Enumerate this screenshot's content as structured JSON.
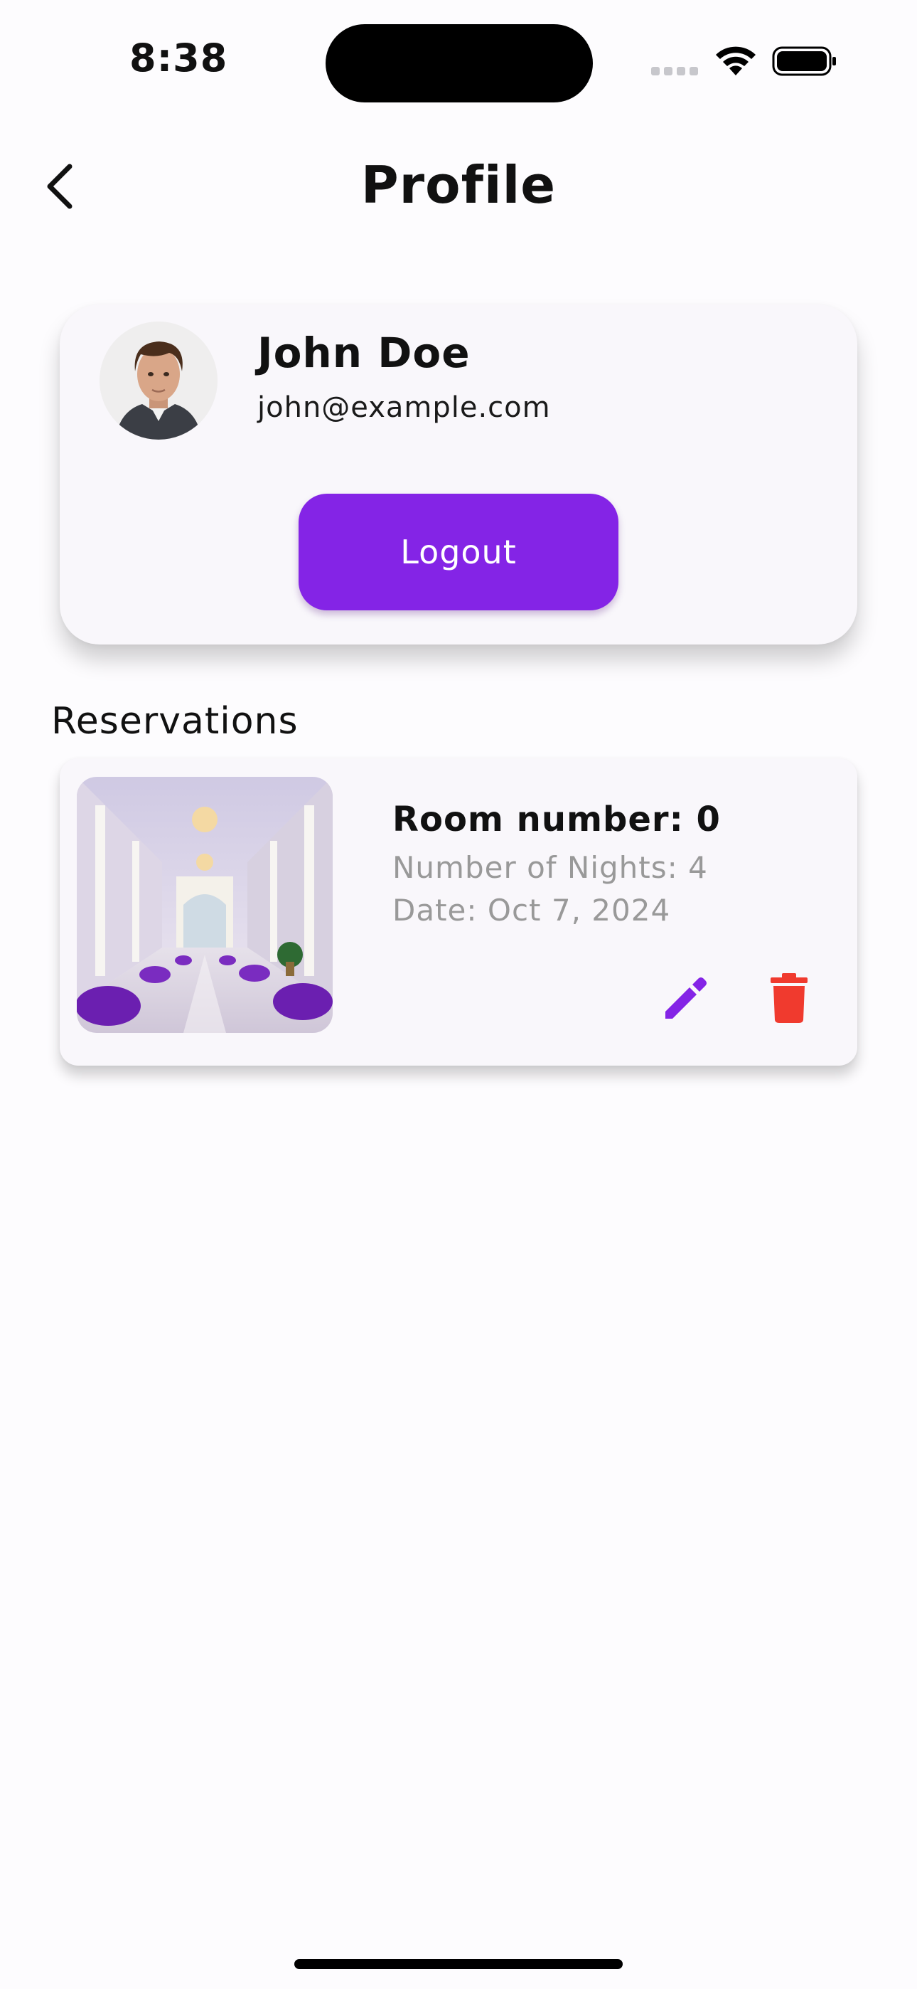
{
  "status_bar": {
    "time": "8:38"
  },
  "header": {
    "title": "Profile",
    "back_icon": "chevron-left-icon"
  },
  "profile": {
    "name": "John Doe",
    "email": "john@example.com",
    "logout_label": "Logout"
  },
  "reservations": {
    "title": "Reservations",
    "items": [
      {
        "room": "Room number: 0",
        "nights": "Number of Nights: 4",
        "date": "Date: Oct 7, 2024",
        "edit_icon": "pencil-icon",
        "delete_icon": "trash-icon"
      }
    ]
  },
  "colors": {
    "accent": "#8424e6",
    "danger": "#f03a2e",
    "muted_text": "#999999",
    "card_bg": "#f9f7fb"
  }
}
